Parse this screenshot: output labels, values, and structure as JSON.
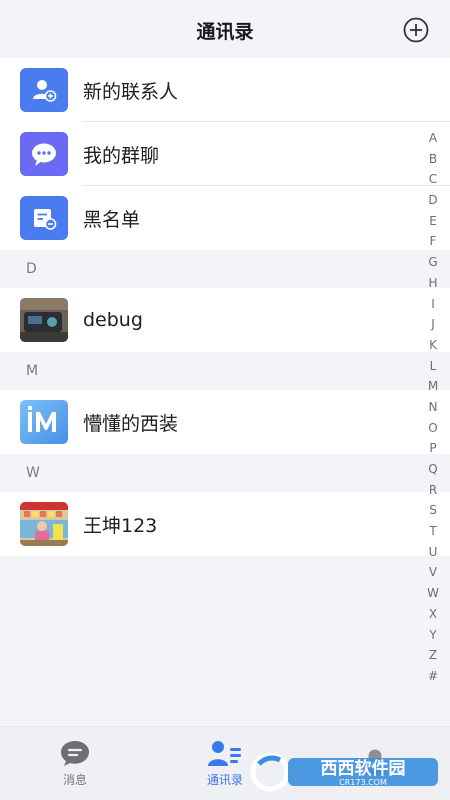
{
  "header": {
    "title": "通讯录"
  },
  "top_items": [
    {
      "label": "新的联系人",
      "icon": "add-contact-icon",
      "color": "#4a7cf0"
    },
    {
      "label": "我的群聊",
      "icon": "group-chat-icon",
      "color": "#6b6af5"
    },
    {
      "label": "黑名单",
      "icon": "blacklist-icon",
      "color": "#4a7cf0"
    }
  ],
  "sections": [
    {
      "letter": "D",
      "contact": {
        "name": "debug"
      }
    },
    {
      "letter": "M",
      "contact": {
        "name": "懵懂的西装"
      }
    },
    {
      "letter": "W",
      "contact": {
        "name": "王坤123"
      }
    }
  ],
  "index_letters": [
    "A",
    "B",
    "C",
    "D",
    "E",
    "F",
    "G",
    "H",
    "I",
    "J",
    "K",
    "L",
    "M",
    "N",
    "O",
    "P",
    "Q",
    "R",
    "S",
    "T",
    "U",
    "V",
    "W",
    "X",
    "Y",
    "Z",
    "#"
  ],
  "tabs": [
    {
      "label": "消息",
      "icon": "message-icon",
      "active": false
    },
    {
      "label": "通讯录",
      "icon": "contacts-icon",
      "active": true
    },
    {
      "label": "",
      "icon": "profile-icon",
      "active": false
    }
  ],
  "watermark": {
    "text": "西西软件园",
    "subtext": "CR173.COM"
  },
  "colors": {
    "accent": "#3b78f0",
    "background": "#f2f4f7"
  }
}
